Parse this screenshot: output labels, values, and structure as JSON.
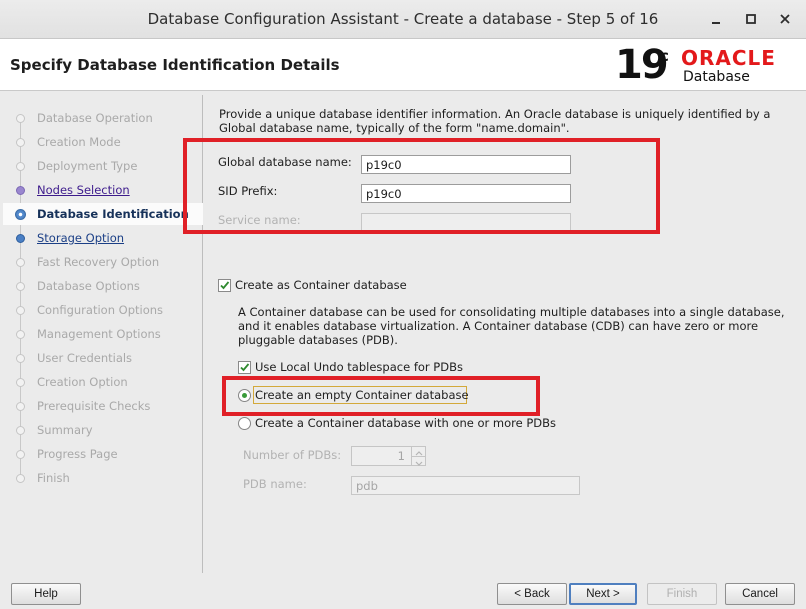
{
  "window": {
    "title": "Database Configuration Assistant - Create a database - Step 5 of 16"
  },
  "header": {
    "heading": "Specify Database Identification Details",
    "logo": {
      "version": "19",
      "version_suffix": "c",
      "brand": "ORACLE",
      "product": "Database"
    }
  },
  "nav": {
    "items": [
      {
        "label": "Database Operation",
        "state": "done"
      },
      {
        "label": "Creation Mode",
        "state": "done"
      },
      {
        "label": "Deployment Type",
        "state": "done"
      },
      {
        "label": "Nodes Selection",
        "state": "link"
      },
      {
        "label": "Database Identification",
        "state": "active"
      },
      {
        "label": "Storage Option",
        "state": "next"
      },
      {
        "label": "Fast Recovery Option",
        "state": "pending"
      },
      {
        "label": "Database Options",
        "state": "pending"
      },
      {
        "label": "Configuration Options",
        "state": "pending"
      },
      {
        "label": "Management Options",
        "state": "pending"
      },
      {
        "label": "User Credentials",
        "state": "pending"
      },
      {
        "label": "Creation Option",
        "state": "pending"
      },
      {
        "label": "Prerequisite Checks",
        "state": "pending"
      },
      {
        "label": "Summary",
        "state": "pending"
      },
      {
        "label": "Progress Page",
        "state": "pending"
      },
      {
        "label": "Finish",
        "state": "pending"
      }
    ]
  },
  "main": {
    "description": "Provide a unique database identifier information. An Oracle database is uniquely identified by a Global database name, typically of the form \"name.domain\".",
    "global_db_name": {
      "label": "Global database name:",
      "value": "p19c0"
    },
    "sid_prefix": {
      "label": "SID Prefix:",
      "value": "p19c0"
    },
    "service_name": {
      "label": "Service name:",
      "value": ""
    },
    "container": {
      "checkbox_label": "Create as Container database",
      "checked": true,
      "description": "A Container database can be used for consolidating multiple databases into a single database, and it enables database virtualization. A Container database (CDB) can have zero or more pluggable databases (PDB).",
      "local_undo_label": "Use Local Undo tablespace for PDBs",
      "local_undo_checked": true,
      "empty_cdb_label": "Create an empty Container database",
      "cdb_with_pdbs_label": "Create a Container database with one or more PDBs",
      "selected_option": "empty",
      "num_pdbs_label": "Number of PDBs:",
      "num_pdbs_value": "1",
      "pdb_name_label": "PDB name:",
      "pdb_name_value": "pdb"
    }
  },
  "buttons": {
    "help": "Help",
    "back": "< Back",
    "next": "Next >",
    "finish": "Finish",
    "cancel": "Cancel"
  },
  "colors": {
    "annotation_red": "#e02027",
    "oracle_red": "#e3191b",
    "focus_border": "#d3a93b"
  }
}
